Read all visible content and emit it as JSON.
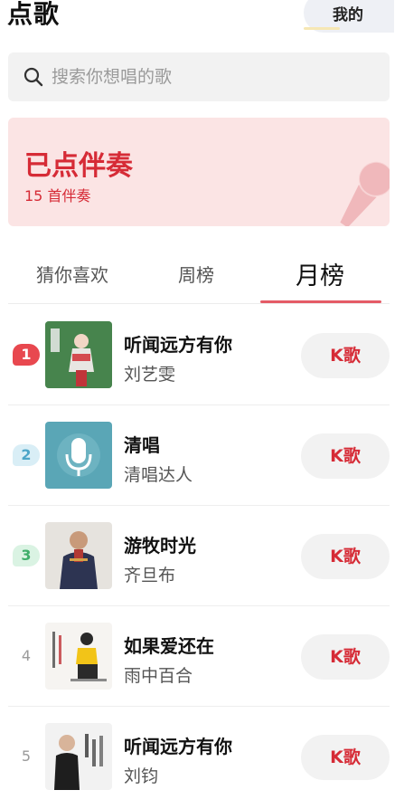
{
  "header": {
    "title": "点歌",
    "my_label": "我的"
  },
  "search": {
    "placeholder": "搜索你想唱的歌"
  },
  "ordered": {
    "title": "已点伴奏",
    "count_text": "15 首伴奏"
  },
  "tabs": [
    {
      "label": "猜你喜欢",
      "active": false
    },
    {
      "label": "周榜",
      "active": false
    },
    {
      "label": "月榜",
      "active": true
    }
  ],
  "songs": [
    {
      "rank": "1",
      "title": "听闻远方有你",
      "artist": "刘艺雯",
      "button": "K歌",
      "badge_color": "#e8484f",
      "badge_text_color": "#ffffff"
    },
    {
      "rank": "2",
      "title": "清唱",
      "artist": "清唱达人",
      "button": "K歌",
      "badge_color": "#d9eef6",
      "badge_text_color": "#4ca5c8"
    },
    {
      "rank": "3",
      "title": "游牧时光",
      "artist": "齐旦布",
      "button": "K歌",
      "badge_color": "#daf3e3",
      "badge_text_color": "#3fae6a"
    },
    {
      "rank": "4",
      "title": "如果爱还在",
      "artist": "雨中百合",
      "button": "K歌"
    },
    {
      "rank": "5",
      "title": "听闻远方有你",
      "artist": "刘钧",
      "button": "K歌"
    }
  ],
  "colors": {
    "accent": "#d62b36",
    "card_bg": "#fbe4e4",
    "tab_underline": "#e45b66"
  },
  "icons": {
    "search": "search-icon",
    "microphone": "microphone-icon"
  }
}
